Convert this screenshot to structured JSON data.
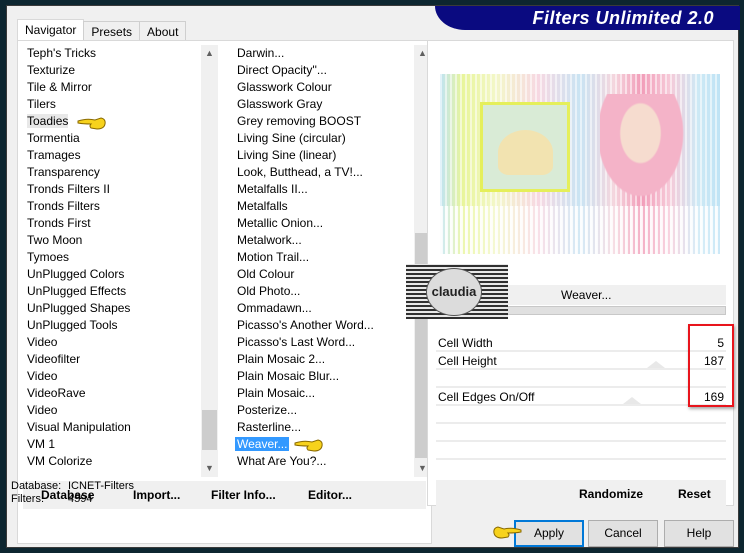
{
  "window": {
    "title": "Filters Unlimited 2.0",
    "accent_color": "#0a0a80",
    "highlight_color": "#e8141c",
    "selection_color": "#3399ff"
  },
  "tabs": [
    {
      "label": "Navigator",
      "active": true
    },
    {
      "label": "Presets",
      "active": false
    },
    {
      "label": "About",
      "active": false
    }
  ],
  "categories": {
    "items": [
      "Teph's Tricks",
      "Texturize",
      "Tile & Mirror",
      "Tilers",
      "Toadies",
      "Tormentia",
      "Tramages",
      "Transparency",
      "Tronds Filters II",
      "Tronds Filters",
      "Tronds First",
      "Two Moon",
      "Tymoes",
      "UnPlugged Colors",
      "UnPlugged Effects",
      "UnPlugged Shapes",
      "UnPlugged Tools",
      "Video",
      "Videofilter",
      "Video",
      "VideoRave",
      "Video",
      "Visual Manipulation",
      "VM 1",
      "VM Colorize"
    ],
    "selected": "Toadies"
  },
  "filters": {
    "items": [
      "Darwin...",
      "Direct Opacity''...",
      "Glasswork Colour",
      "Glasswork Gray",
      "Grey removing BOOST",
      "Living Sine (circular)",
      "Living Sine (linear)",
      "Look, Butthead, a TV!...",
      "Metalfalls II...",
      "Metalfalls",
      "Metallic Onion...",
      "Metalwork...",
      "Motion Trail...",
      "Old Colour",
      "Old Photo...",
      "Ommadawn...",
      "Picasso's Another Word...",
      "Picasso's Last Word...",
      "Plain Mosaic 2...",
      "Plain Mosaic Blur...",
      "Plain Mosaic...",
      "Posterize...",
      "Rasterline...",
      "Weaver...",
      "What Are You?..."
    ],
    "selected": "Weaver..."
  },
  "left_buttons": {
    "database": "Database",
    "import": "Import...",
    "filter_info": "Filter Info...",
    "editor": "Editor..."
  },
  "status": {
    "database_label": "Database:",
    "database_value": "ICNET-Filters",
    "filters_label": "Filters:",
    "filters_value": "4594"
  },
  "preview": {
    "filter_name": "Weaver...",
    "watermark_text": "claudia"
  },
  "parameters": [
    {
      "label": "Cell Width",
      "value": "5"
    },
    {
      "label": "Cell Height",
      "value": "187"
    },
    {
      "label": "",
      "value": ""
    },
    {
      "label": "Cell Edges On/Off",
      "value": "169"
    },
    {
      "label": "",
      "value": ""
    },
    {
      "label": "",
      "value": ""
    },
    {
      "label": "",
      "value": ""
    }
  ],
  "right_buttons": {
    "randomize": "Randomize",
    "reset": "Reset"
  },
  "dialog_buttons": {
    "apply": "Apply",
    "cancel": "Cancel",
    "help": "Help"
  }
}
